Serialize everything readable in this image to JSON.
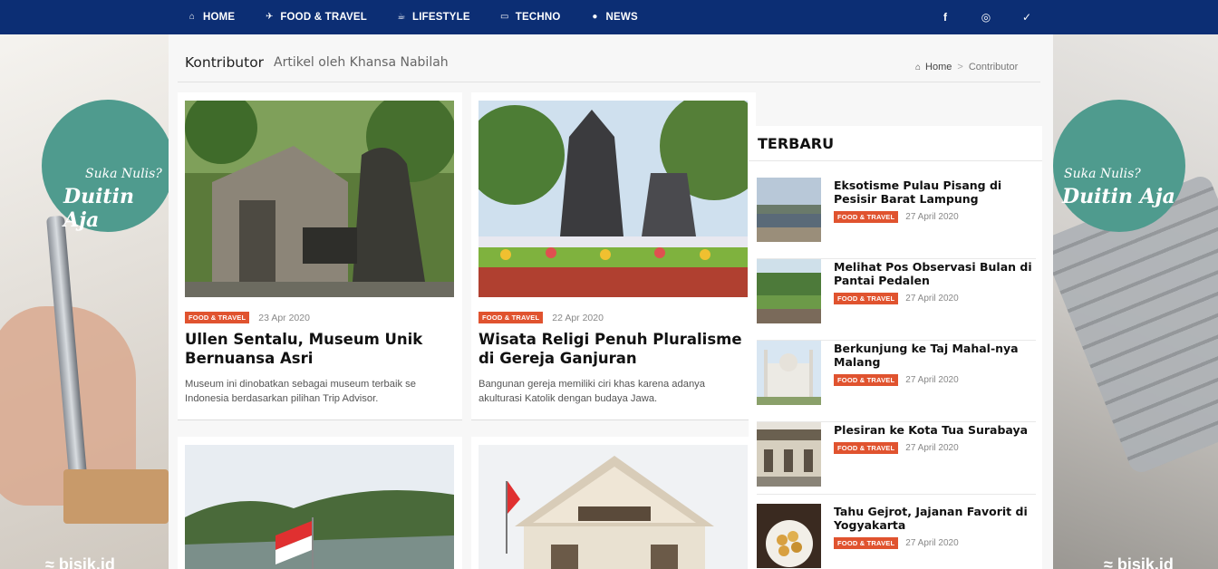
{
  "nav": {
    "items": [
      {
        "label": "HOME",
        "icon": "home-icon",
        "glyph": "⌂"
      },
      {
        "label": "FOOD & TRAVEL",
        "icon": "plane-icon",
        "glyph": "✈"
      },
      {
        "label": "LIFESTYLE",
        "icon": "coffee-icon",
        "glyph": "☕"
      },
      {
        "label": "TECHNO",
        "icon": "monitor-icon",
        "glyph": "▭"
      },
      {
        "label": "NEWS",
        "icon": "globe-icon",
        "glyph": "●"
      }
    ],
    "social": [
      {
        "label": "f",
        "icon": "facebook-icon"
      },
      {
        "label": "◎",
        "icon": "instagram-icon"
      },
      {
        "label": "✓",
        "icon": "twitter-icon"
      }
    ],
    "bg_color": "#0c2e74"
  },
  "banner": {
    "tagline_small": "Suka Nulis?",
    "tagline_big": "Duitin Aja",
    "watermark": "≈ bisik.id",
    "circle_color": "#4f9b8e"
  },
  "page": {
    "title": "Kontributor",
    "subtitle": "Artikel oleh Khansa Nabilah",
    "breadcrumb": {
      "home": "Home",
      "sep": ">",
      "current": "Contributor"
    }
  },
  "posts": [
    {
      "category": "FOOD & TRAVEL",
      "date": "23 Apr 2020",
      "title": "Ullen Sentalu, Museum Unik Bernuansa Asri",
      "excerpt": "Museum ini dinobatkan sebagai museum terbaik se Indonesia berdasarkan pilihan Trip Advisor."
    },
    {
      "category": "FOOD & TRAVEL",
      "date": "22 Apr 2020",
      "title": "Wisata Religi Penuh Pluralisme di Gereja Ganjuran",
      "excerpt": "Bangunan gereja memiliki ciri khas karena adanya akulturasi Katolik dengan budaya Jawa."
    },
    {
      "category": "",
      "date": "",
      "title": "",
      "excerpt": ""
    },
    {
      "category": "",
      "date": "",
      "title": "",
      "excerpt": ""
    }
  ],
  "sidebar": {
    "title": "TERBARU",
    "items": [
      {
        "title": "Eksotisme Pulau Pisang di Pesisir Barat Lampung",
        "category": "FOOD & TRAVEL",
        "date": "27 April 2020"
      },
      {
        "title": "Melihat Pos Observasi Bulan di Pantai Pedalen",
        "category": "FOOD & TRAVEL",
        "date": "27 April 2020"
      },
      {
        "title": "Berkunjung ke Taj Mahal-nya Malang",
        "category": "FOOD & TRAVEL",
        "date": "27 April 2020"
      },
      {
        "title": "Plesiran ke Kota Tua Surabaya",
        "category": "FOOD & TRAVEL",
        "date": "27 April 2020"
      },
      {
        "title": "Tahu Gejrot, Jajanan Favorit di Yogyakarta",
        "category": "FOOD & TRAVEL",
        "date": "27 April 2020"
      }
    ]
  },
  "colors": {
    "category_badge": "#e0532f"
  }
}
